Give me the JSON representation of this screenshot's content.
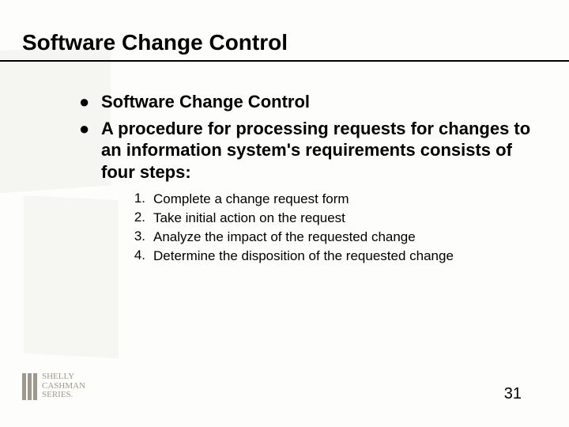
{
  "title": "Software Change Control",
  "bullets": [
    "Software Change Control",
    "A procedure for processing requests for changes to an information system's requirements consists of four steps:"
  ],
  "steps": [
    {
      "n": "1.",
      "text": "Complete a change request form"
    },
    {
      "n": "2.",
      "text": "Take initial action on the request"
    },
    {
      "n": "3.",
      "text": "Analyze the impact of the requested change"
    },
    {
      "n": "4.",
      "text": "Determine the disposition of the requested change"
    }
  ],
  "page_number": "31",
  "logo": {
    "line1": "SHELLY",
    "line2": "CASHMAN",
    "line3": "SERIES."
  }
}
